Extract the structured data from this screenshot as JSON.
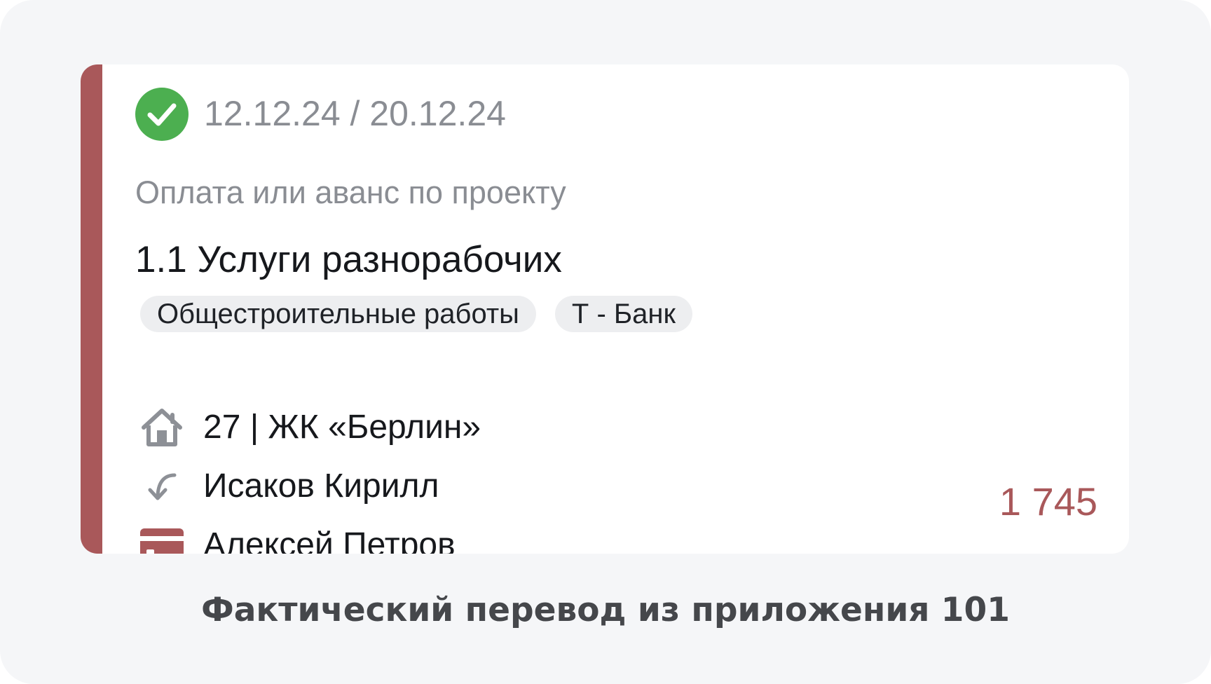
{
  "transfer": {
    "status": "completed",
    "dates": "12.12.24 / 20.12.24",
    "payment_type": "Оплата или аванс по проекту",
    "item_title": "1.1 Услуги разнорабочих",
    "tags": [
      "Общестроительные работы",
      "Т - Банк"
    ],
    "object": "27 | ЖК «Берлин»",
    "from_person": "Исаков Кирилл",
    "card_holder": "Алексей Петров",
    "amount": "1 745"
  },
  "caption": "Фактический перевод из приложения 101",
  "icons": {
    "status": "check-circle-icon",
    "object": "house-icon",
    "from": "incoming-arrow-icon",
    "card": "credit-card-icon"
  },
  "colors": {
    "accent": "#a9585a",
    "success": "#4caf50",
    "muted_text": "#8a8d93",
    "tag_bg": "#edeef0",
    "page_bg": "#f5f6f8"
  }
}
